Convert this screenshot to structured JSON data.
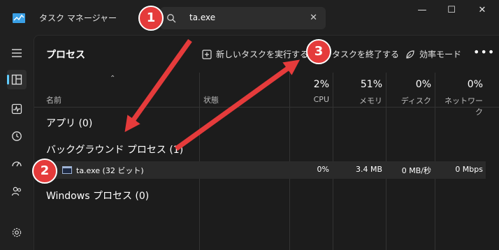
{
  "window": {
    "title": "タスク マネージャー",
    "search_value": "ta.exe",
    "controls": {
      "minimize": "—",
      "maximize": "☐",
      "close": "✕"
    }
  },
  "sidebar": {
    "items": [
      {
        "icon": "hamburger-icon"
      },
      {
        "icon": "processes-icon",
        "active": true
      },
      {
        "icon": "performance-icon"
      },
      {
        "icon": "app-history-icon"
      },
      {
        "icon": "startup-icon"
      },
      {
        "icon": "users-icon"
      },
      {
        "icon": "settings-icon"
      }
    ]
  },
  "toolbar": {
    "title": "プロセス",
    "new_task": "新しいタスクを実行する",
    "end_task": "タスクを終了する",
    "efficiency": "効率モード",
    "more": "•••"
  },
  "columns": {
    "name": "名前",
    "status": "状態",
    "cpu": {
      "pct": "2%",
      "label": "CPU"
    },
    "memory": {
      "pct": "51%",
      "label": "メモリ"
    },
    "disk": {
      "pct": "0%",
      "label": "ディスク"
    },
    "network": {
      "pct": "0%",
      "label": "ネットワーク"
    }
  },
  "groups": {
    "apps": "アプリ (0)",
    "background": "バックグラウンド プロセス (1)",
    "windows": "Windows プロセス (0)"
  },
  "process_row": {
    "name": "ta.exe (32 ビット)",
    "cpu": "0%",
    "memory": "3.4 MB",
    "disk": "0 MB/秒",
    "network": "0 Mbps"
  },
  "annotations": {
    "step1": "1",
    "step2": "2",
    "step3": "3"
  },
  "colors": {
    "accent": "#60cdff",
    "annotation": "#e53b3b",
    "background": "#202020"
  }
}
